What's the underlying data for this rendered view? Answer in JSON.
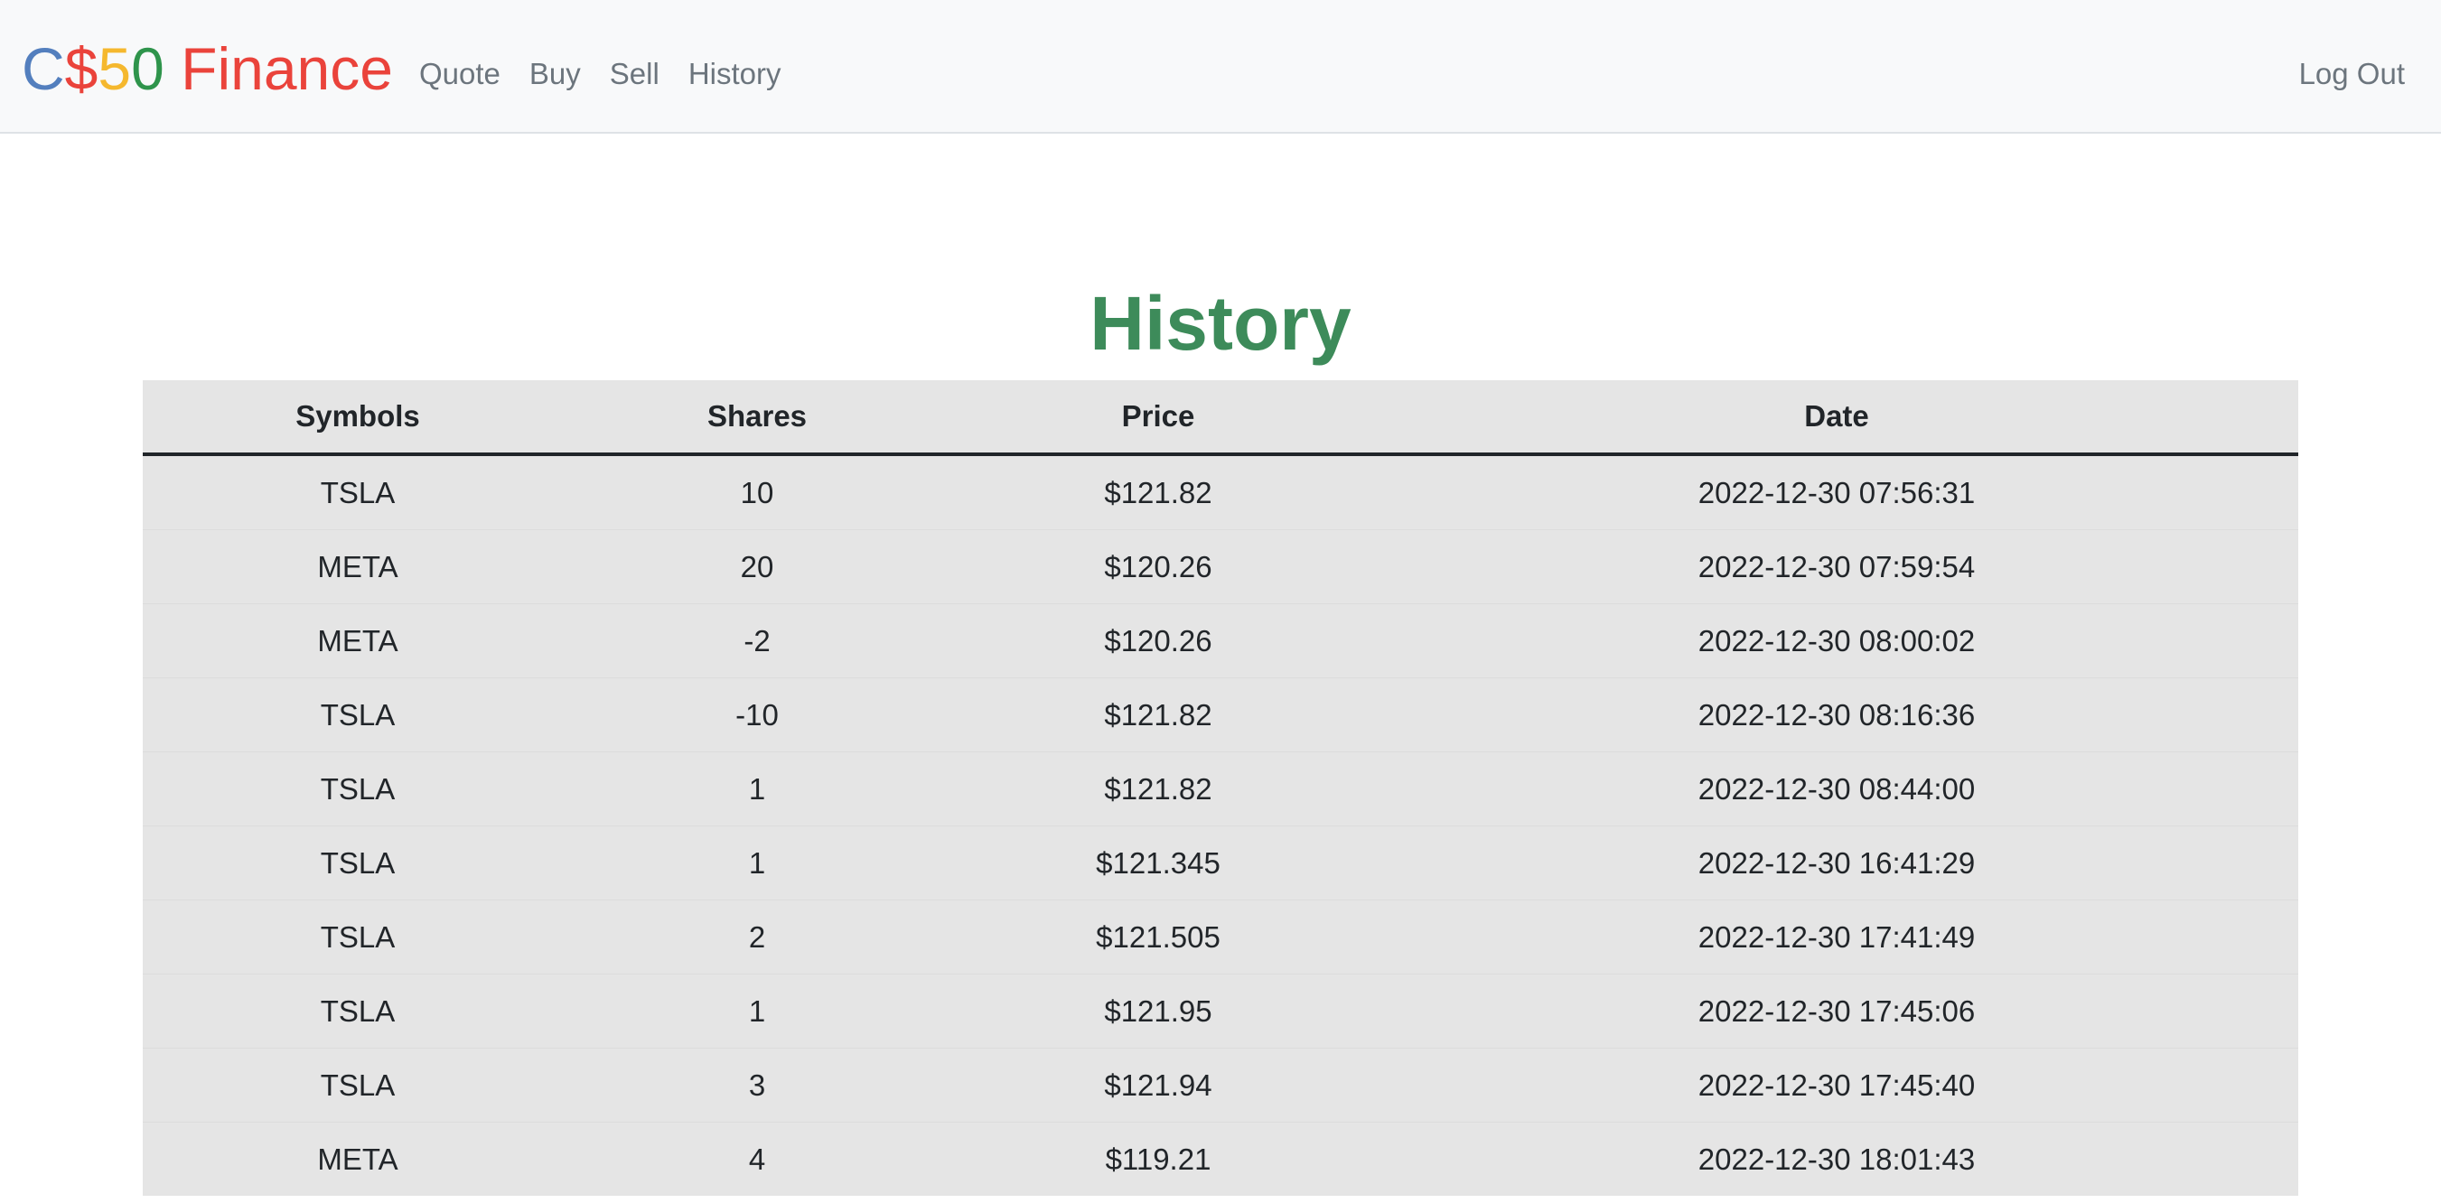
{
  "brand": {
    "parts": [
      {
        "text": "C",
        "color": "#537fbe"
      },
      {
        "text": "$",
        "color": "#ea433b"
      },
      {
        "text": "5",
        "color": "#f5b82e"
      },
      {
        "text": "0",
        "color": "#2e944b"
      },
      {
        "text": " Finance",
        "color": "#ea433b"
      }
    ]
  },
  "nav": {
    "links": [
      "Quote",
      "Buy",
      "Sell",
      "History"
    ],
    "logout": "Log Out"
  },
  "page": {
    "title": "History",
    "title_color": "#3d8b5a"
  },
  "table": {
    "headers": [
      "Symbols",
      "Shares",
      "Price",
      "Date"
    ],
    "rows": [
      [
        "TSLA",
        "10",
        "$121.82",
        "2022-12-30 07:56:31"
      ],
      [
        "META",
        "20",
        "$120.26",
        "2022-12-30 07:59:54"
      ],
      [
        "META",
        "-2",
        "$120.26",
        "2022-12-30 08:00:02"
      ],
      [
        "TSLA",
        "-10",
        "$121.82",
        "2022-12-30 08:16:36"
      ],
      [
        "TSLA",
        "1",
        "$121.82",
        "2022-12-30 08:44:00"
      ],
      [
        "TSLA",
        "1",
        "$121.345",
        "2022-12-30 16:41:29"
      ],
      [
        "TSLA",
        "2",
        "$121.505",
        "2022-12-30 17:41:49"
      ],
      [
        "TSLA",
        "1",
        "$121.95",
        "2022-12-30 17:45:06"
      ],
      [
        "TSLA",
        "3",
        "$121.94",
        "2022-12-30 17:45:40"
      ],
      [
        "META",
        "4",
        "$119.21",
        "2022-12-30 18:01:43"
      ]
    ]
  }
}
